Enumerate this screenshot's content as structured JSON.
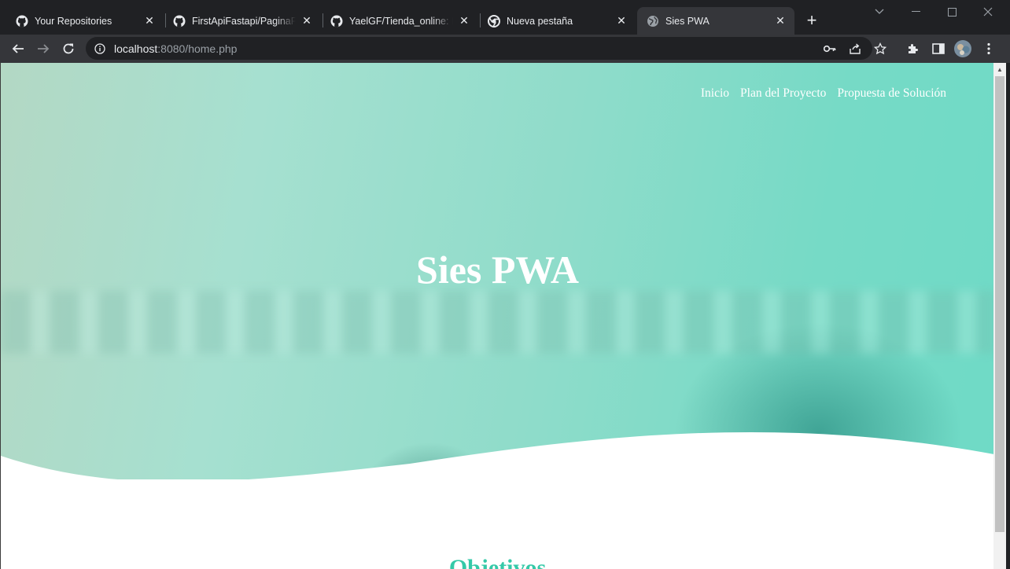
{
  "browser": {
    "tabs": [
      {
        "title": "Your Repositories",
        "icon": "github-icon",
        "active": false
      },
      {
        "title": "FirstApiFastapi/PaginaFastapi",
        "icon": "github-icon",
        "active": false
      },
      {
        "title": "YaelGF/Tienda_online: Desarrollo",
        "icon": "github-icon",
        "active": false
      },
      {
        "title": "Nueva pestaña",
        "icon": "chrome-icon",
        "active": false
      },
      {
        "title": "Sies PWA",
        "icon": "globe-icon",
        "active": true
      }
    ],
    "url_host": "localhost",
    "url_path": ":8080/home.php"
  },
  "site": {
    "nav": [
      "Inicio",
      "Plan del Proyecto",
      "Propuesta de Solución"
    ],
    "hero_title": "Sies PWA",
    "section_title": "Objetivos"
  },
  "colors": {
    "accent": "#35c9a8",
    "browser_bg": "#202124",
    "toolbar_bg": "#35363a"
  }
}
